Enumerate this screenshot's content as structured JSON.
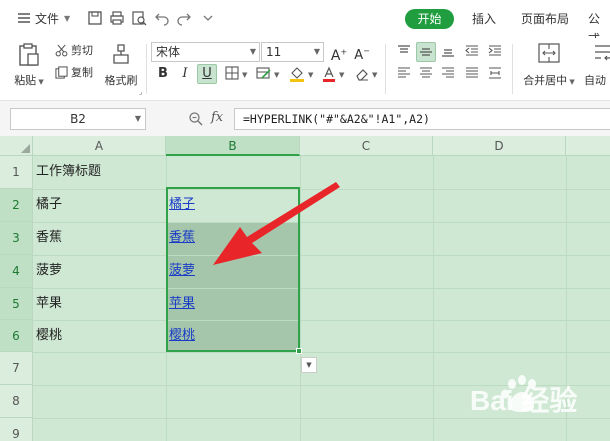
{
  "menubar": {
    "file_label": "文件",
    "tabs": [
      {
        "label": "开始",
        "active": true
      },
      {
        "label": "插入"
      },
      {
        "label": "页面布局"
      },
      {
        "label": "公式"
      }
    ]
  },
  "ribbon": {
    "paste_label": "粘贴",
    "cut_label": "剪切",
    "copy_label": "复制",
    "format_painter_label": "格式刷",
    "font_name": "宋体",
    "font_size": "11",
    "bold": "B",
    "italic": "I",
    "underline": "U",
    "merge_label": "合并居中",
    "wrap_label": "自动"
  },
  "formula_bar": {
    "name_box": "B2",
    "fx": "fx",
    "formula": "=HYPERLINK(\"#\"&A2&\"!A1\",A2)"
  },
  "sheet": {
    "columns": [
      "A",
      "B",
      "C",
      "D"
    ],
    "rows": [
      "1",
      "2",
      "3",
      "4",
      "5",
      "6",
      "7",
      "8",
      "9"
    ],
    "selected_column": "B",
    "cells": {
      "A1": "工作簿标题",
      "A2": "橘子",
      "A3": "香蕉",
      "A4": "菠萝",
      "A5": "苹果",
      "A6": "樱桃",
      "B2": "橘子",
      "B3": "香蕉",
      "B4": "菠萝",
      "B5": "苹果",
      "B6": "樱桃"
    }
  },
  "colors": {
    "accent": "#1f9d3f",
    "grid_bg": "#cfe8d3",
    "link": "#1a3cc7",
    "annotation_arrow": "#e8262a"
  },
  "watermark": {
    "text": "Bai 经验"
  }
}
